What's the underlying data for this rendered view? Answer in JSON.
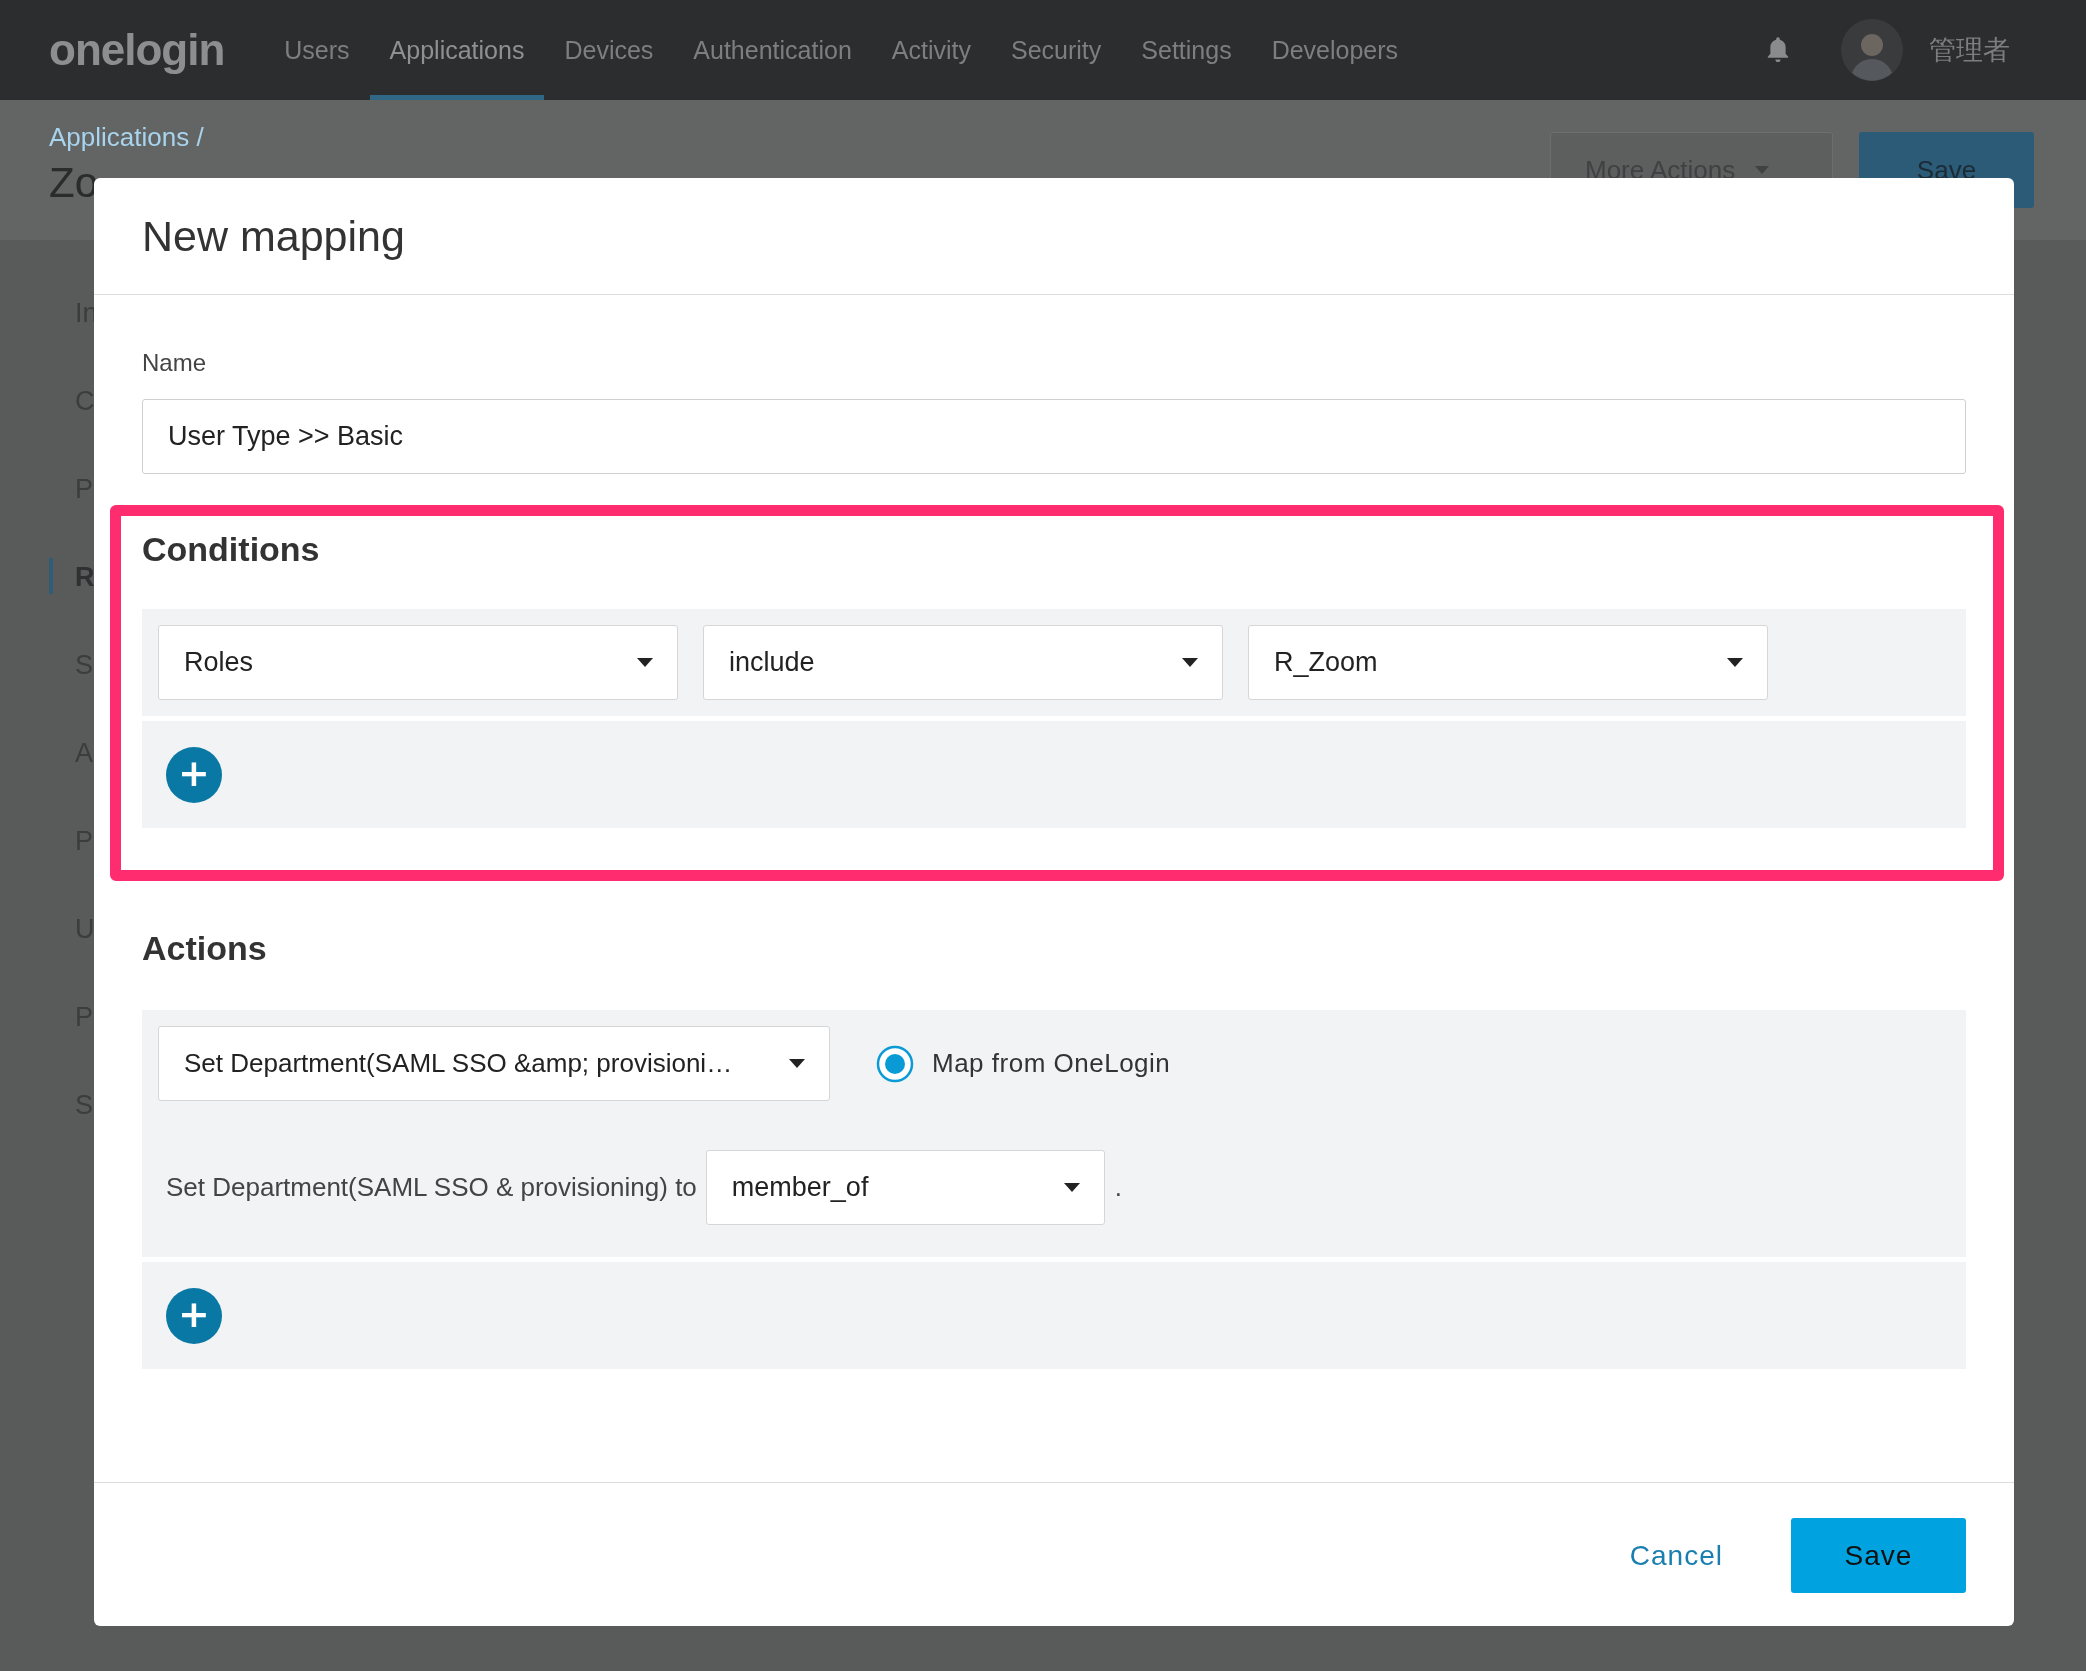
{
  "nav": {
    "logo": "onelogin",
    "items": [
      {
        "label": "Users",
        "selected": false
      },
      {
        "label": "Applications",
        "selected": true
      },
      {
        "label": "Devices",
        "selected": false
      },
      {
        "label": "Authentication",
        "selected": false
      },
      {
        "label": "Activity",
        "selected": false
      },
      {
        "label": "Security",
        "selected": false
      },
      {
        "label": "Settings",
        "selected": false
      },
      {
        "label": "Developers",
        "selected": false
      }
    ],
    "user": "管理者"
  },
  "page": {
    "breadcrumb": "Applications /",
    "title": "Zo",
    "buttons": [
      {
        "label": "More Actions",
        "kind": "dropdown"
      },
      {
        "label": "Save",
        "kind": "primary"
      }
    ],
    "sidebar": [
      {
        "label": "In",
        "selected": false
      },
      {
        "label": "C",
        "selected": false
      },
      {
        "label": "P",
        "selected": false
      },
      {
        "label": "R",
        "selected": true
      },
      {
        "label": "S",
        "selected": false
      },
      {
        "label": "A",
        "selected": false
      },
      {
        "label": "P",
        "selected": false
      },
      {
        "label": "U",
        "selected": false
      },
      {
        "label": "P",
        "selected": false
      },
      {
        "label": "S",
        "selected": false
      }
    ]
  },
  "modal": {
    "title": "New mapping",
    "name_label": "Name",
    "name_value": "User Type >> Basic",
    "conditions": {
      "title": "Conditions",
      "add": "+",
      "rows": [
        {
          "fields": [
            "Roles",
            "include",
            "R_Zoom"
          ]
        }
      ]
    },
    "actions": {
      "title": "Actions",
      "add": "+",
      "rows": [
        {
          "field": "Set Department(SAML SSO &amp; provisioni…",
          "option": {
            "label": "Map from OneLogin",
            "selected": true
          },
          "sentence": "Set Department(SAML SSO & provisioning) to",
          "value": "member_of",
          "end": "."
        }
      ]
    },
    "buttons": [
      {
        "label": "Cancel",
        "kind": "link"
      },
      {
        "label": "Save",
        "kind": "primary"
      }
    ]
  }
}
